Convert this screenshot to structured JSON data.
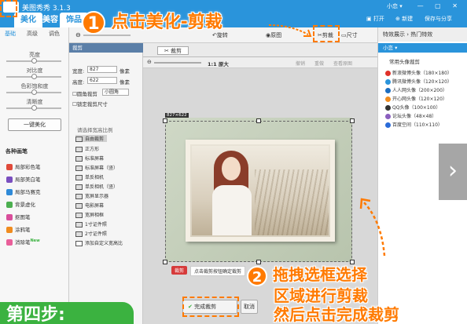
{
  "app": {
    "title": "美图秀秀 3.1.3",
    "user": "小恋 ▾",
    "window_controls": "— ▢ ✕"
  },
  "tabs": [
    {
      "label": "美化"
    },
    {
      "label": "美容"
    },
    {
      "label": "饰品"
    }
  ],
  "top_buttons": {
    "open": "打开",
    "new": "新建",
    "save_share": "保存与分享"
  },
  "left_subtabs": [
    "基础",
    "高级",
    "调色"
  ],
  "sliders": [
    {
      "label": "亮度",
      "value": 0.5
    },
    {
      "label": "对比度",
      "value": 0.5
    },
    {
      "label": "色彩饱和度",
      "value": 0.5
    },
    {
      "label": "清晰度",
      "value": 0.5
    }
  ],
  "one_key": "一键美化",
  "brushes": {
    "heading": "各种画笔",
    "items": [
      {
        "label": "局部彩色笔",
        "color": "#e04a3a"
      },
      {
        "label": "局部美白笔",
        "color": "#7a4fbf"
      },
      {
        "label": "局部马赛克",
        "color": "#2f8ad8"
      },
      {
        "label": "背景虚化",
        "color": "#4caf50"
      },
      {
        "label": "抠图笔",
        "color": "#d94e9b"
      },
      {
        "label": "涂鸦笔",
        "color": "#f08c1f"
      },
      {
        "label": "消除笔",
        "color": "#e95f9a",
        "badge": "New"
      }
    ]
  },
  "toolbar2": {
    "rotate": "旋转",
    "crop": "剪裁",
    "size": "尺寸",
    "original": "原图",
    "undo": "撤销",
    "redo": "重做"
  },
  "crop_dialog": {
    "title": "裁剪",
    "width_label": "宽度:",
    "width_value": "827",
    "width_unit": "像素",
    "height_label": "高度:",
    "height_value": "622",
    "height_unit": "像素",
    "round_crop": "圆角裁剪",
    "round_select": "小圆角",
    "lock_size": "锁定裁剪尺寸",
    "ratio_heading": "请选择宽高比例",
    "ratios": [
      "自由裁剪",
      "正方形",
      "标准屏幕",
      "标准屏幕（竖）",
      "单反相机",
      "单反相机（竖）",
      "宽屏显示器",
      "电影屏幕",
      "宽屏相框",
      "1寸证件照",
      "2寸证件照",
      "添加自定义宽高比"
    ]
  },
  "canvas": {
    "tab": "裁剪",
    "zoom": "1:1 原大",
    "tool_undo": "撤销",
    "tool_redo": "重做",
    "tool_original": "查看原图",
    "size_readout": "827×622",
    "hint_tag": "裁剪",
    "hint_text": "点击裁剪按钮确定裁剪"
  },
  "right_panel": {
    "head": "特效展示 › 热门特效",
    "sub": "小恋 ▾",
    "heading": "常用头像裁剪",
    "items": [
      {
        "label": "新浪微博头像（180×180）",
        "color": "#e0322a"
      },
      {
        "label": "腾讯微博头像（120×120）",
        "color": "#2a94db"
      },
      {
        "label": "人人网头像（200×200）",
        "color": "#1d6ec0"
      },
      {
        "label": "开心网头像（120×120）",
        "color": "#f08c1f"
      },
      {
        "label": "QQ头像（100×100）",
        "color": "#333333"
      },
      {
        "label": "论坛头像（48×48）",
        "color": "#8b5fbf"
      },
      {
        "label": "百度空间（110×110）",
        "color": "#2a6bd8"
      }
    ]
  },
  "buttons": {
    "done": "完成裁剪",
    "cancel": "取消"
  },
  "callouts": {
    "step1_num": "1",
    "step1_text": "点击美化-剪裁",
    "step2_num": "2",
    "step2_line1": "拖拽选框选择",
    "step2_line2": "区域进行剪裁",
    "step2_line3": "然后点击完成裁剪",
    "step4": "第四步:"
  },
  "colors": {
    "accent": "#2a94db",
    "callout": "#ff7a00",
    "step_green": "#3bb240"
  }
}
